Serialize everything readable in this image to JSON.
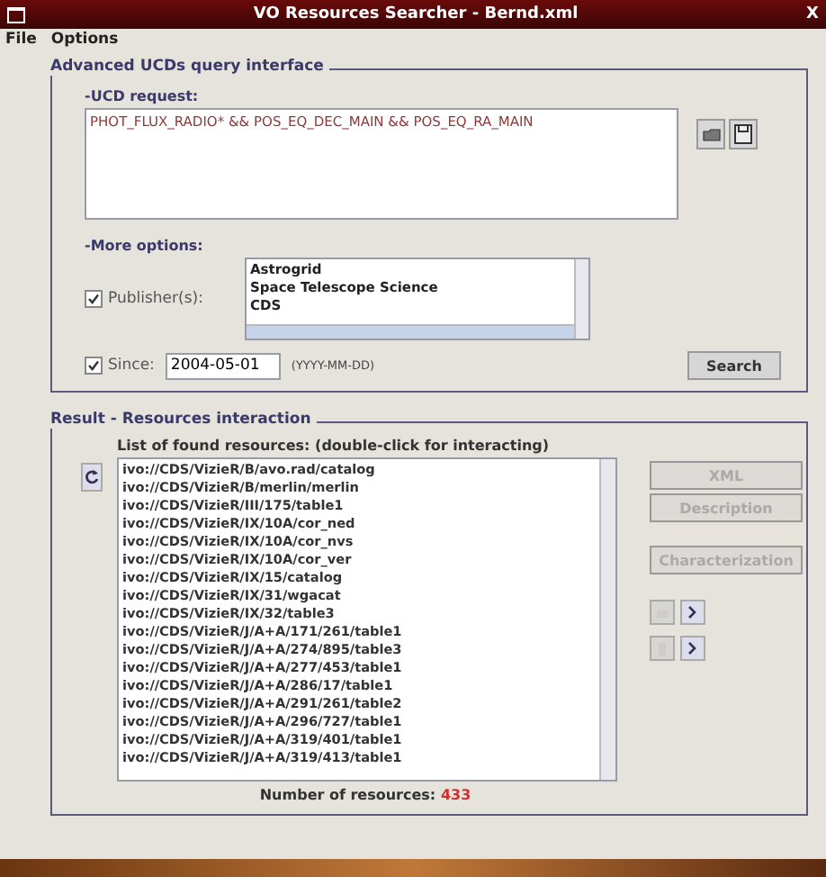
{
  "window": {
    "title": "VO Resources Searcher - Bernd.xml",
    "close": "X"
  },
  "menu": [
    "File",
    "Options"
  ],
  "query_panel": {
    "title": "Advanced UCDs query interface",
    "ucd_label": "-UCD request:",
    "ucd_value": "PHOT_FLUX_RADIO* && POS_EQ_DEC_MAIN && POS_EQ_RA_MAIN",
    "more_label": "-More options:",
    "publishers": {
      "label": "Publisher(s):",
      "checked": true,
      "items": [
        "Astrogrid",
        "Space Telescope Science",
        "CDS"
      ]
    },
    "since": {
      "label": "Since:",
      "checked": true,
      "value": "2004-05-01",
      "hint": "(YYYY-MM-DD)"
    },
    "search_button": "Search"
  },
  "result_panel": {
    "title": "Result - Resources interaction",
    "list_label": "List of found resources: (double-click for interacting)",
    "resources": [
      "ivo://CDS/VizieR/B/avo.rad/catalog",
      "ivo://CDS/VizieR/B/merlin/merlin",
      "ivo://CDS/VizieR/III/175/table1",
      "ivo://CDS/VizieR/IX/10A/cor_ned",
      "ivo://CDS/VizieR/IX/10A/cor_nvs",
      "ivo://CDS/VizieR/IX/10A/cor_ver",
      "ivo://CDS/VizieR/IX/15/catalog",
      "ivo://CDS/VizieR/IX/31/wgacat",
      "ivo://CDS/VizieR/IX/32/table3",
      "ivo://CDS/VizieR/J/A+A/171/261/table1",
      "ivo://CDS/VizieR/J/A+A/274/895/table3",
      "ivo://CDS/VizieR/J/A+A/277/453/table1",
      "ivo://CDS/VizieR/J/A+A/286/17/table1",
      "ivo://CDS/VizieR/J/A+A/291/261/table2",
      "ivo://CDS/VizieR/J/A+A/296/727/table1",
      "ivo://CDS/VizieR/J/A+A/319/401/table1",
      "ivo://CDS/VizieR/J/A+A/319/413/table1"
    ],
    "buttons": [
      {
        "label": "XML",
        "disabled": true
      },
      {
        "label": "Description",
        "disabled": true
      },
      {
        "label": "Characterization",
        "disabled": true
      }
    ],
    "count_label": "Number of resources:",
    "count": "433"
  }
}
